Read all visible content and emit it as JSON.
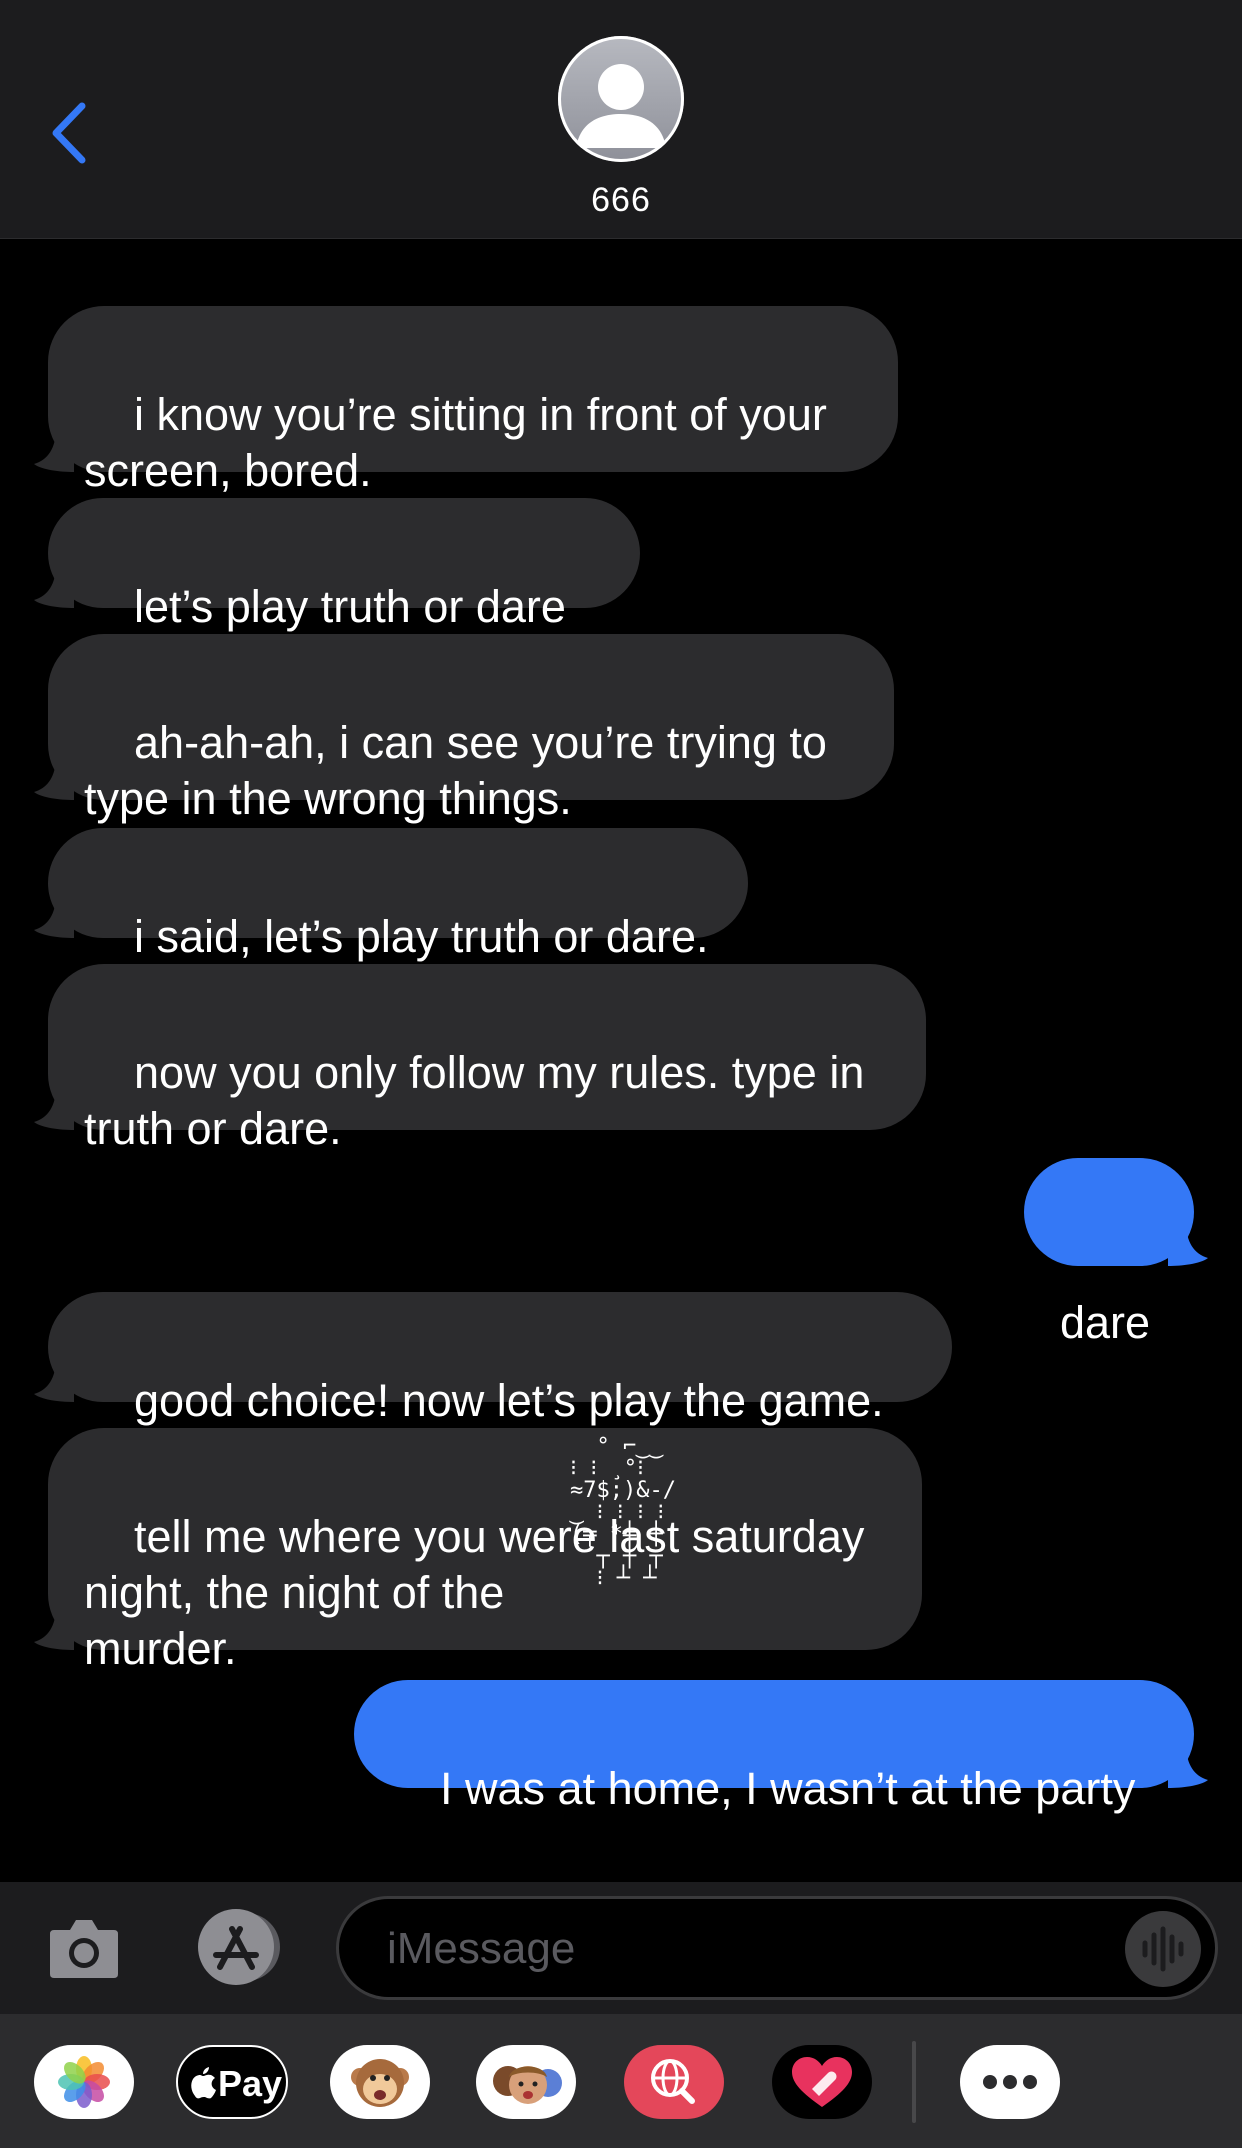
{
  "header": {
    "contact_name": "666",
    "contact_name_glyphs": "̛̗̃ ̤̆ ̈́̕"
  },
  "messages": [
    {
      "side": "in",
      "text": "i know you’re sitting in front of your\nscreen, bored."
    },
    {
      "side": "in",
      "text": "let’s play truth or dare :)"
    },
    {
      "side": "in",
      "text": "ah-ah-ah, i can see you’re trying to\ntype in the wrong things."
    },
    {
      "side": "in",
      "text": "i said, let’s play truth or dare."
    },
    {
      "side": "in",
      "text": "now you only follow my rules. type in\ntruth or dare."
    },
    {
      "side": "out",
      "text": "dare"
    },
    {
      "side": "in",
      "text": "good choice! now let’s play the game."
    },
    {
      "side": "in",
      "text": "tell me where you were last saturday\nnight, the night of the\nmurder."
    },
    {
      "side": "out",
      "text": "I was at home, I wasn’t at the party"
    }
  ],
  "glitch_text": "  ° ⌐‿‿\n⁝ ⁝ ¸°⁝\n≈7$;)&-/\n‿ ⁝ ⁝ ⁝ ⁝\n(╤ *╪ ┼\n  ┬ ┼ ┬\n  ⁝ ┴ ┴",
  "input": {
    "placeholder": "iMessage"
  },
  "app_drawer": {
    "items": [
      "Photos",
      "Apple Pay",
      "Animoji",
      "Memoji",
      "Images",
      "Digital Touch",
      "More"
    ],
    "apple_pay_label": "Pay"
  },
  "colors": {
    "incoming_bubble": "#2c2c2e",
    "outgoing_bubble": "#3478f6",
    "accent": "#3478f6",
    "background": "#000000"
  }
}
